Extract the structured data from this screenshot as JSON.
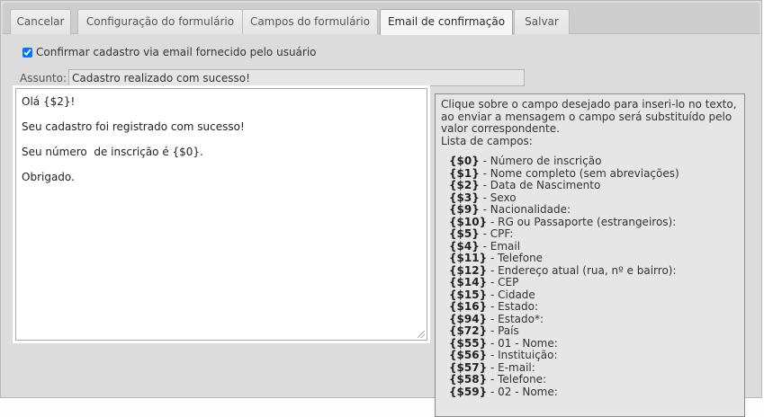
{
  "tabs": [
    {
      "label": "Cancelar"
    },
    {
      "label": "Configuração do formulário"
    },
    {
      "label": "Campos do formulário"
    },
    {
      "label": "Email de confirmação"
    },
    {
      "label": "Salvar"
    }
  ],
  "active_tab": "Email de confirmação",
  "confirm_checkbox": {
    "label": "Confirmar cadastro via email fornecido pelo usuário",
    "checked": true
  },
  "subject": {
    "label": "Assunto:",
    "value": "Cadastro realizado com sucesso!"
  },
  "editor": {
    "lines": [
      "Olá {$2}!",
      "Seu cadastro foi registrado com sucesso!",
      "Seu número  de inscrição é {$0}.",
      "Obrigado."
    ]
  },
  "help": {
    "intro": "Clique sobre o campo desejado para inseri-lo no texto, ao enviar a mensagem o campo será substituído pelo valor correspondente.",
    "list_title": "Lista de campos:",
    "fields": [
      {
        "code": "{$0}",
        "name": "- Número de inscrição"
      },
      {
        "code": "{$1}",
        "name": "- Nome completo (sem abreviações)"
      },
      {
        "code": "{$2}",
        "name": "- Data de Nascimento"
      },
      {
        "code": "{$3}",
        "name": "- Sexo"
      },
      {
        "code": "{$9}",
        "name": "- Nacionalidade:"
      },
      {
        "code": "{$10}",
        "name": "- RG ou Passaporte (estrangeiros):"
      },
      {
        "code": "{$5}",
        "name": "- CPF:"
      },
      {
        "code": "{$4}",
        "name": "- Email"
      },
      {
        "code": "{$11}",
        "name": "- Telefone"
      },
      {
        "code": "{$12}",
        "name": "- Endereço atual (rua, nº e bairro):"
      },
      {
        "code": "{$14}",
        "name": "- CEP"
      },
      {
        "code": "{$15}",
        "name": "- Cidade"
      },
      {
        "code": "{$16}",
        "name": "- Estado:"
      },
      {
        "code": "{$94}",
        "name": "- Estado*:"
      },
      {
        "code": "{$72}",
        "name": "- País"
      },
      {
        "code": "{$55}",
        "name": "- 01 - Nome:"
      },
      {
        "code": "{$56}",
        "name": "- Instituição:"
      },
      {
        "code": "{$57}",
        "name": "- E-mail:"
      },
      {
        "code": "{$58}",
        "name": "- Telefone:"
      },
      {
        "code": "{$59}",
        "name": "- 02 - Nome:"
      }
    ]
  }
}
